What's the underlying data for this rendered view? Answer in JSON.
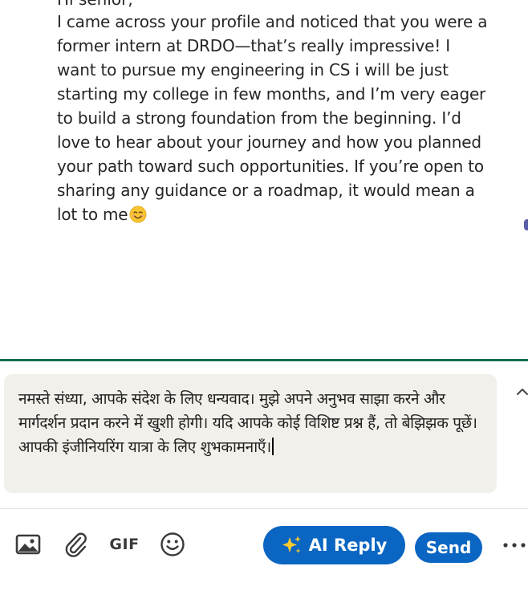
{
  "message": {
    "greeting": "Hi senior,",
    "body": "I came across your profile and noticed that you were a former intern at DRDO—that’s really impressive! I want to pursue my engineering in CS i will be just starting my college in few months, and I’m very eager to build a strong foundation from the beginning. I’d love to hear about your journey and how you planned your path toward such opportunities. If you’re open to sharing any guidance or a roadmap, it would mean a lot to me",
    "emoji": "smiling-face-icon"
  },
  "composer": {
    "text": "नमस्ते संध्या, आपके संदेश के लिए धन्यवाद। मुझे अपने अनुभव साझा करने और मार्गदर्शन प्रदान करने में खुशी होगी। यदि आपके कोई विशिष्ट प्रश्न हैं, तो बेझिझक पूछें। आपकी इंजीनियरिंग यात्रा के लिए शुभकामनाएँ।"
  },
  "toolbar": {
    "icons": [
      "image-icon",
      "paperclip-icon",
      "gif-icon",
      "emoji-icon"
    ],
    "gif_label": "GIF",
    "ai_reply_label": "AI Reply",
    "send_label": "Send",
    "more_icon": "more-horizontal-icon"
  },
  "colors": {
    "accent": "#0a66c2",
    "divider_green": "#0a6e4b",
    "composer_bg": "#f2f0ea"
  }
}
